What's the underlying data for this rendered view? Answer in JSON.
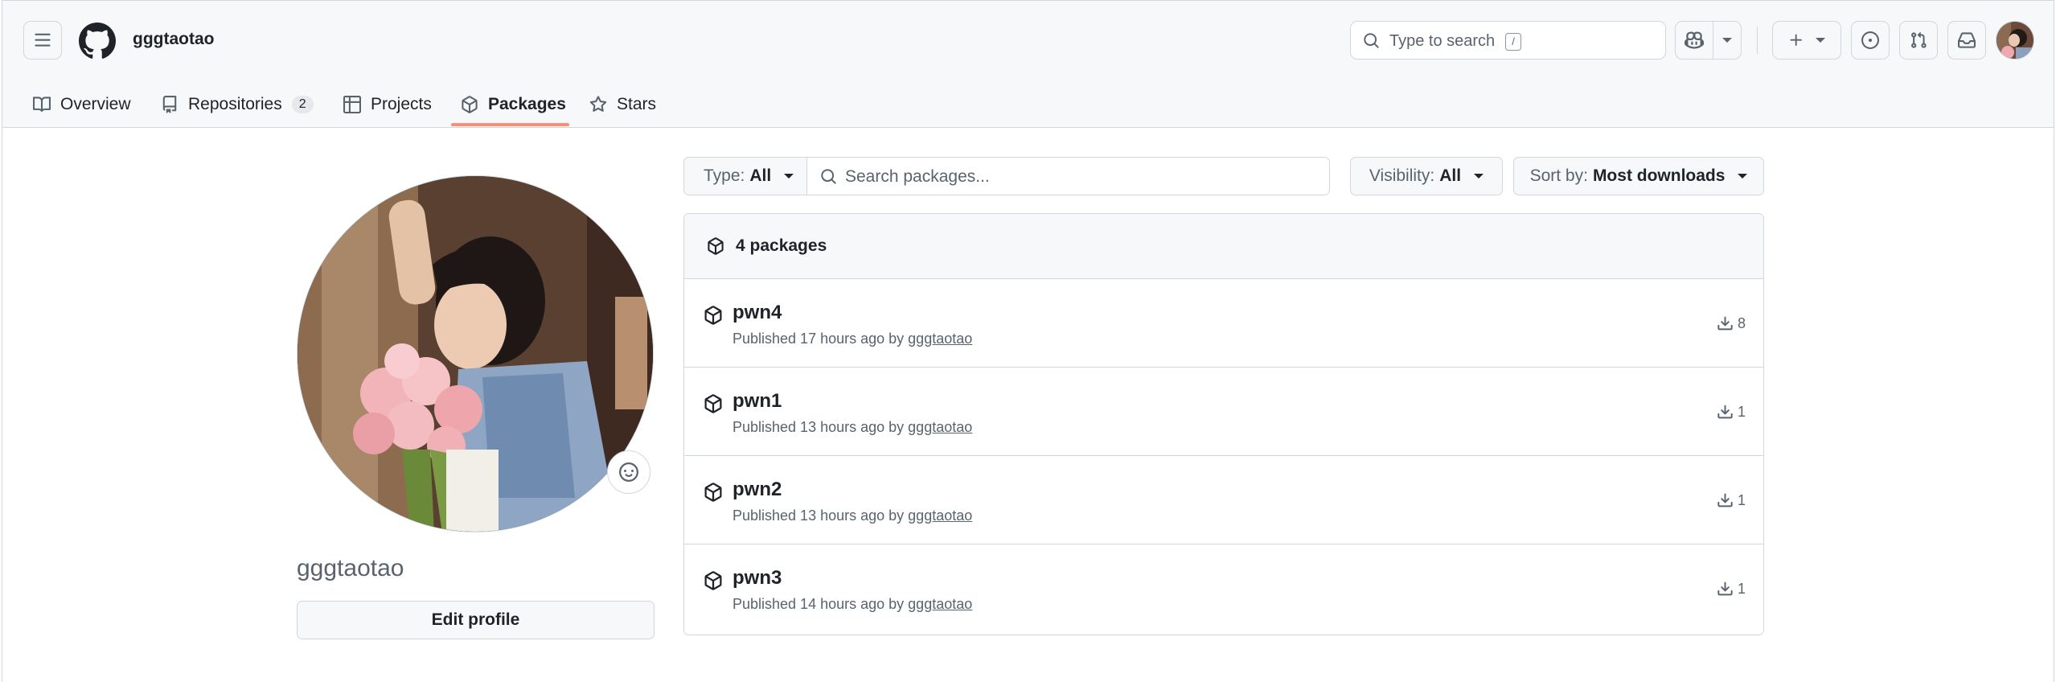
{
  "header": {
    "username": "gggtaotao",
    "search_placeholder": "Type to search",
    "search_shortcut": "/"
  },
  "tabs": [
    {
      "label": "Overview",
      "icon": "book-icon"
    },
    {
      "label": "Repositories",
      "icon": "repo-icon",
      "count": "2"
    },
    {
      "label": "Projects",
      "icon": "table-icon"
    },
    {
      "label": "Packages",
      "icon": "package-icon",
      "active": true
    },
    {
      "label": "Stars",
      "icon": "star-icon"
    }
  ],
  "profile": {
    "name": "gggtaotao",
    "edit_label": "Edit profile"
  },
  "filters": {
    "type_label": "Type:",
    "type_value": "All",
    "search_placeholder": "Search packages...",
    "visibility_label": "Visibility:",
    "visibility_value": "All",
    "sort_label": "Sort by:",
    "sort_value": "Most downloads"
  },
  "packages": {
    "count_label": "4 packages",
    "items": [
      {
        "name": "pwn4",
        "published": "Published 17 hours ago by",
        "user": "gggtaotao",
        "downloads": "8"
      },
      {
        "name": "pwn1",
        "published": "Published 13 hours ago by",
        "user": "gggtaotao",
        "downloads": "1"
      },
      {
        "name": "pwn2",
        "published": "Published 13 hours ago by",
        "user": "gggtaotao",
        "downloads": "1"
      },
      {
        "name": "pwn3",
        "published": "Published 14 hours ago by",
        "user": "gggtaotao",
        "downloads": "1"
      }
    ]
  },
  "colors": {
    "active_tab_underline": "#fd8c73",
    "border": "#d0d7de",
    "header_bg": "#f6f8fa"
  }
}
